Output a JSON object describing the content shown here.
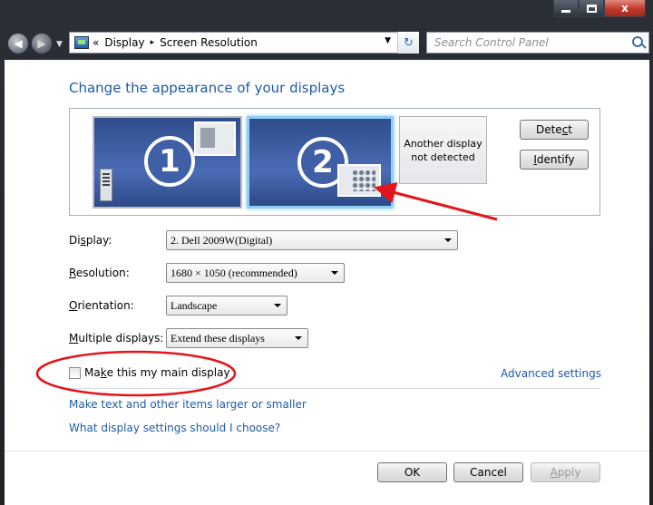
{
  "window": {
    "caption_buttons": {
      "minimize": "",
      "maximize": "",
      "close": "x"
    }
  },
  "nav": {
    "breadcrumb_prefix": "«",
    "breadcrumb": [
      "Display",
      "Screen Resolution"
    ],
    "breadcrumb_separator": "▸",
    "search_placeholder": "Search Control Panel"
  },
  "main": {
    "heading": "Change the appearance of your displays",
    "monitors": [
      {
        "number": "1"
      },
      {
        "number": "2"
      }
    ],
    "another_display": "Another display not detected",
    "detect_button": {
      "pre": "Dete",
      "accel": "c",
      "post": "t"
    },
    "identify_button": {
      "pre": "",
      "accel": "I",
      "post": "dentify"
    },
    "fields": {
      "display": {
        "label_pre": "Di",
        "label_accel": "s",
        "label_post": "play:",
        "value": "2. Dell 2009W(Digital)"
      },
      "resolution": {
        "label_pre": "",
        "label_accel": "R",
        "label_post": "esolution:",
        "value": "1680 × 1050 (recommended)"
      },
      "orientation": {
        "label_pre": "",
        "label_accel": "O",
        "label_post": "rientation:",
        "value": "Landscape"
      },
      "multiple": {
        "label_pre": "",
        "label_accel": "M",
        "label_post": "ultiple displays:",
        "value": "Extend these displays"
      }
    },
    "main_display_checkbox": {
      "label_pre": "Ma",
      "label_accel": "k",
      "label_post": "e this my main display",
      "checked": false
    },
    "advanced_settings": "Advanced settings",
    "link_text_size": "Make text and other items larger or smaller",
    "link_help": "What display settings should I choose?"
  },
  "footer": {
    "ok": "OK",
    "cancel": "Cancel",
    "apply": {
      "pre": "",
      "accel": "A",
      "post": "pply"
    }
  },
  "colors": {
    "link": "#1e5aa8",
    "annotation": "#e3151a"
  }
}
